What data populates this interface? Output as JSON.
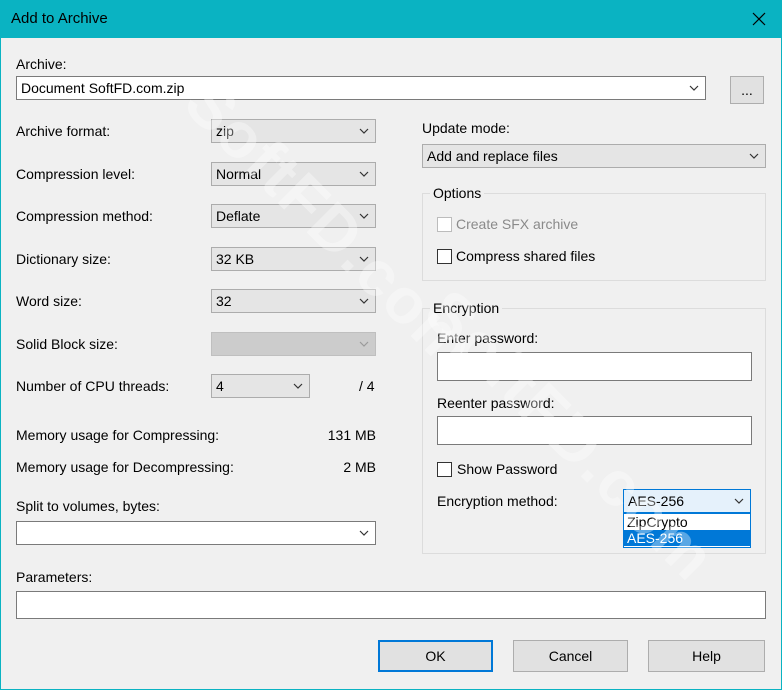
{
  "window": {
    "title": "Add to Archive"
  },
  "archive": {
    "label": "Archive:",
    "value": "Document SoftFD.com.zip",
    "browse_label": "..."
  },
  "left": {
    "archive_format": {
      "label": "Archive format:",
      "value": "zip"
    },
    "compression_level": {
      "label": "Compression level:",
      "value": "Normal"
    },
    "compression_method": {
      "label": "Compression method:",
      "value": "Deflate"
    },
    "dictionary_size": {
      "label": "Dictionary size:",
      "value": "32 KB"
    },
    "word_size": {
      "label": "Word size:",
      "value": "32"
    },
    "solid_block_size": {
      "label": "Solid Block size:",
      "value": ""
    },
    "cpu_threads": {
      "label": "Number of CPU threads:",
      "value": "4",
      "max": "/ 4"
    },
    "memory_compress": {
      "label": "Memory usage for Compressing:",
      "value": "131 MB"
    },
    "memory_decompress": {
      "label": "Memory usage for Decompressing:",
      "value": "2 MB"
    },
    "split_volumes": {
      "label": "Split to volumes, bytes:",
      "value": ""
    }
  },
  "right": {
    "update_mode": {
      "label": "Update mode:",
      "value": "Add and replace files"
    },
    "options": {
      "title": "Options",
      "create_sfx": {
        "label": "Create SFX archive",
        "checked": false,
        "enabled": false
      },
      "compress_shared": {
        "label": "Compress shared files",
        "checked": false
      }
    },
    "encryption": {
      "title": "Encryption",
      "enter_password": {
        "label": "Enter password:",
        "value": ""
      },
      "reenter_password": {
        "label": "Reenter password:",
        "value": ""
      },
      "show_password": {
        "label": "Show Password",
        "checked": false
      },
      "method": {
        "label": "Encryption method:",
        "value": "AES-256",
        "options": [
          "ZipCrypto",
          "AES-256"
        ],
        "highlighted": "AES-256"
      }
    }
  },
  "parameters": {
    "label": "Parameters:",
    "value": ""
  },
  "buttons": {
    "ok": "OK",
    "cancel": "Cancel",
    "help": "Help"
  },
  "watermark": "SoftFD.com",
  "colors": {
    "titlebar": "#0ab3c2",
    "accent": "#0078d7",
    "dialog_bg": "#f0f0f0"
  },
  "icons": [
    "close-icon",
    "chevron-down-icon"
  ]
}
